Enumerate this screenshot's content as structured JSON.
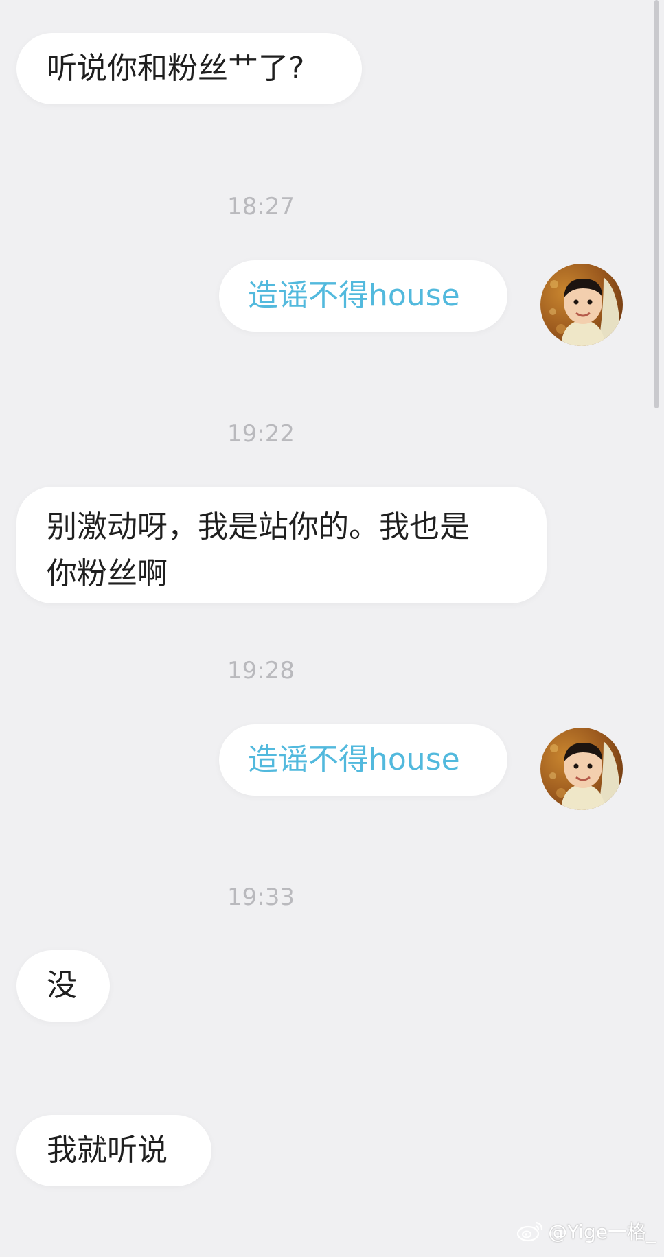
{
  "messages": [
    {
      "text": "听说你和粉丝艹了?"
    },
    {
      "time": "18:27"
    },
    {
      "text": "造谣不得house"
    },
    {
      "time": "19:22"
    },
    {
      "text": "别激动呀，我是站你的。我也是\n你粉丝啊"
    },
    {
      "time": "19:28"
    },
    {
      "text": "造谣不得house"
    },
    {
      "time": "19:33"
    },
    {
      "text": "没"
    },
    {
      "text": "我就听说"
    }
  ],
  "colors": {
    "background": "#f0f0f2",
    "bubble": "#ffffff",
    "outgoing_text": "#52b9dd",
    "incoming_text": "#1f1f1f",
    "timestamp": "#b9b9bd"
  },
  "watermark": {
    "text": "@Yige一格_",
    "icon": "weibo-icon"
  }
}
